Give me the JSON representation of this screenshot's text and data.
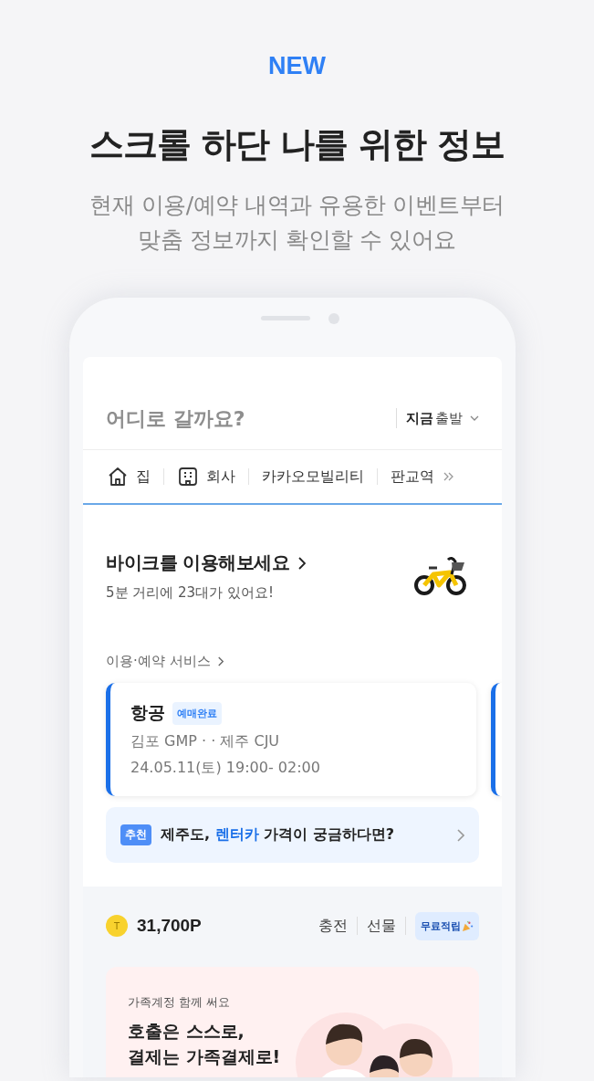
{
  "header": {
    "badge": "NEW",
    "title": "스크롤 하단 나를 위한 정보",
    "subtitle_lines": [
      "현재 이용/예약 내역과 유용한 이벤트부터",
      "맞춤 정보까지 확인할 수 있어요"
    ]
  },
  "phone": {
    "search": {
      "placeholder": "어디로 갈까요?",
      "departure_time": "지금",
      "departure_label": "출발"
    },
    "shortcuts": [
      {
        "label": "집",
        "kind": "home"
      },
      {
        "label": "회사",
        "kind": "office"
      },
      {
        "label": "카카오모빌리티"
      },
      {
        "label": "판교역"
      }
    ],
    "bike": {
      "title": "바이크를 이용해보세요",
      "subtitle": "5분 거리에 23대가 있어요!"
    },
    "services": {
      "label": "이용·예약 서비스"
    },
    "reservation": {
      "category": "항공",
      "status": "예매완료",
      "route": "김포 GMP · · 제주 CJU",
      "time": "24.05.11(토) 19:00- 02:00"
    },
    "recommendation": {
      "tag": "추천",
      "text": "제주도, **렌터카** 가격이 궁금하다면?"
    },
    "points": {
      "coin": "T",
      "amount": "31,700P",
      "actions": [
        "충전",
        "선물"
      ],
      "promo": "무료적립"
    },
    "family": {
      "eyebrow": "가족계정 함께 써요",
      "headline_lines": [
        "호출은 스스로,",
        "결제는 가족결제로!"
      ]
    }
  }
}
